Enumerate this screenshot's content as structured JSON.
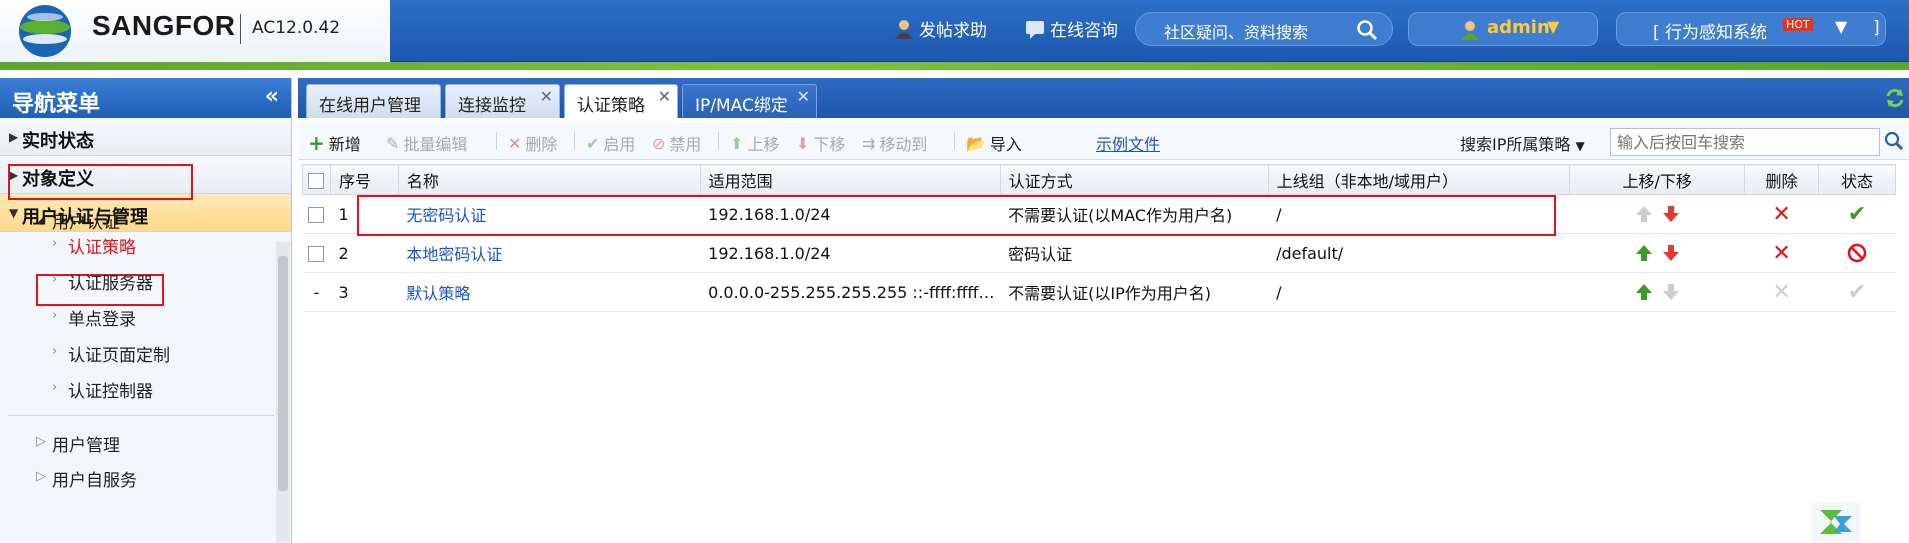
{
  "header": {
    "brand": "SANGFOR",
    "version": "AC12.0.42",
    "links": [
      {
        "label": "发帖求助",
        "icon": "user-help-icon"
      },
      {
        "label": "在线咨询",
        "icon": "chat-icon"
      }
    ],
    "search_label": "社区疑问、资料搜索",
    "user": "admin",
    "system_label": "[ 行为感知系统",
    "hot_badge": "HOT",
    "system_close": "]"
  },
  "sidebar": {
    "title": "导航菜单",
    "collapse": "«",
    "groups": [
      {
        "label": "实时状态"
      },
      {
        "label": "对象定义"
      },
      {
        "label": "用户认证与管理"
      }
    ],
    "section": "用户认证",
    "items": [
      "认证策略",
      "认证服务器",
      "单点登录",
      "认证页面定制",
      "认证控制器"
    ],
    "bottom": [
      "用户管理",
      "用户自服务"
    ]
  },
  "tabs": [
    {
      "label": "在线用户管理"
    },
    {
      "label": "连接监控"
    },
    {
      "label": "认证策略"
    },
    {
      "label": "IP/MAC绑定"
    }
  ],
  "toolbar": {
    "add": "新增",
    "batch_edit": "批量编辑",
    "delete": "删除",
    "enable": "启用",
    "disable": "禁用",
    "move_up": "上移",
    "move_down": "下移",
    "move_to": "移动到",
    "import": "导入",
    "example": "示例文件",
    "search_label": "搜索IP所属策略",
    "search_placeholder": "输入后按回车搜索"
  },
  "table": {
    "headers": [
      "序号",
      "名称",
      "适用范围",
      "认证方式",
      "上线组（非本地/域用户）",
      "上移/下移",
      "删除",
      "状态"
    ],
    "rows": [
      {
        "no": "1",
        "name": "无密码认证",
        "scope": "192.168.1.0/24",
        "method": "不需要认证(以MAC作为用户名)",
        "group": "/",
        "status": "enabled"
      },
      {
        "no": "2",
        "name": "本地密码认证",
        "scope": "192.168.1.0/24",
        "method": "密码认证",
        "group": "/default/",
        "status": "disabled"
      },
      {
        "no": "3",
        "name": "默认策略",
        "scope": "0.0.0.0-255.255.255.255 ::-ffff:ffff…",
        "method": "不需要认证(以IP作为用户名)",
        "group": "/",
        "status": "locked"
      }
    ]
  },
  "colors": {
    "header_blue": "#1c58b0",
    "highlight_red": "#e0141c",
    "link_blue": "#1a55c9",
    "green": "#3d9a2a"
  }
}
